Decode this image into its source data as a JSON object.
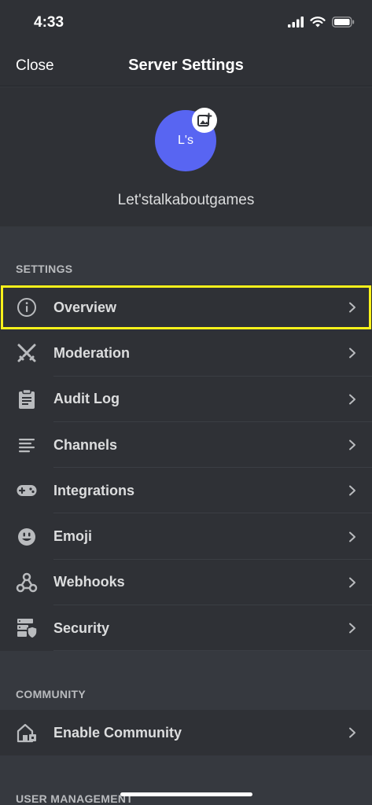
{
  "status_bar": {
    "time": "4:33"
  },
  "header": {
    "close_label": "Close",
    "title": "Server Settings"
  },
  "server": {
    "avatar_initials": "L's",
    "name": "Let'stalkaboutgames"
  },
  "sections": {
    "settings_title": "SETTINGS",
    "community_title": "COMMUNITY",
    "user_management_title": "USER MANAGEMENT"
  },
  "settings_items": [
    {
      "label": "Overview",
      "icon": "info-icon"
    },
    {
      "label": "Moderation",
      "icon": "crossed-swords-icon"
    },
    {
      "label": "Audit Log",
      "icon": "clipboard-icon"
    },
    {
      "label": "Channels",
      "icon": "channels-icon"
    },
    {
      "label": "Integrations",
      "icon": "gamepad-icon"
    },
    {
      "label": "Emoji",
      "icon": "smiley-icon"
    },
    {
      "label": "Webhooks",
      "icon": "webhook-icon"
    },
    {
      "label": "Security",
      "icon": "security-icon"
    }
  ],
  "community_items": [
    {
      "label": "Enable Community",
      "icon": "community-icon"
    }
  ],
  "colors": {
    "background": "#36393f",
    "surface": "#2f3136",
    "accent": "#5865f2",
    "highlight": "#f9f21b",
    "text": "#dcddde"
  }
}
